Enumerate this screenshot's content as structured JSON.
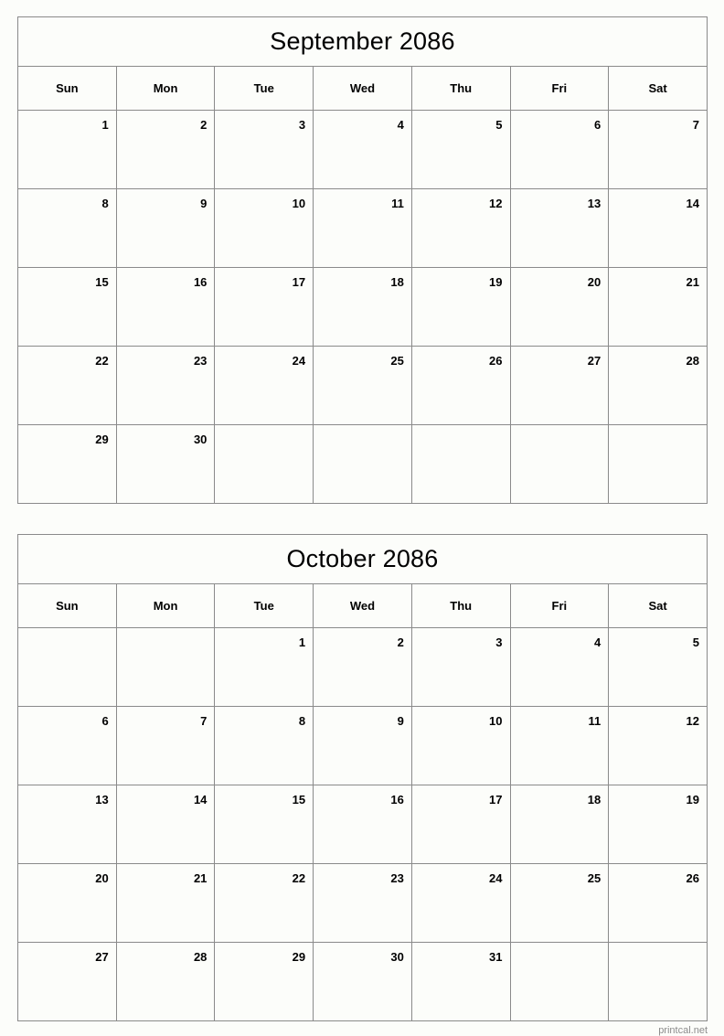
{
  "page": {
    "footer_text": "printcal.net",
    "background_color": "#fcfdfa",
    "border_color": "#8a8a8a",
    "text_color": "#000000",
    "footer_color": "#8c8c8c"
  },
  "calendars": [
    {
      "title": "September 2086",
      "weekday_headers": [
        "Sun",
        "Mon",
        "Tue",
        "Wed",
        "Thu",
        "Fri",
        "Sat"
      ],
      "weeks": [
        [
          "1",
          "2",
          "3",
          "4",
          "5",
          "6",
          "7"
        ],
        [
          "8",
          "9",
          "10",
          "11",
          "12",
          "13",
          "14"
        ],
        [
          "15",
          "16",
          "17",
          "18",
          "19",
          "20",
          "21"
        ],
        [
          "22",
          "23",
          "24",
          "25",
          "26",
          "27",
          "28"
        ],
        [
          "29",
          "30",
          "",
          "",
          "",
          "",
          ""
        ]
      ]
    },
    {
      "title": "October 2086",
      "weekday_headers": [
        "Sun",
        "Mon",
        "Tue",
        "Wed",
        "Thu",
        "Fri",
        "Sat"
      ],
      "weeks": [
        [
          "",
          "",
          "1",
          "2",
          "3",
          "4",
          "5"
        ],
        [
          "6",
          "7",
          "8",
          "9",
          "10",
          "11",
          "12"
        ],
        [
          "13",
          "14",
          "15",
          "16",
          "17",
          "18",
          "19"
        ],
        [
          "20",
          "21",
          "22",
          "23",
          "24",
          "25",
          "26"
        ],
        [
          "27",
          "28",
          "29",
          "30",
          "31",
          "",
          ""
        ]
      ]
    }
  ]
}
